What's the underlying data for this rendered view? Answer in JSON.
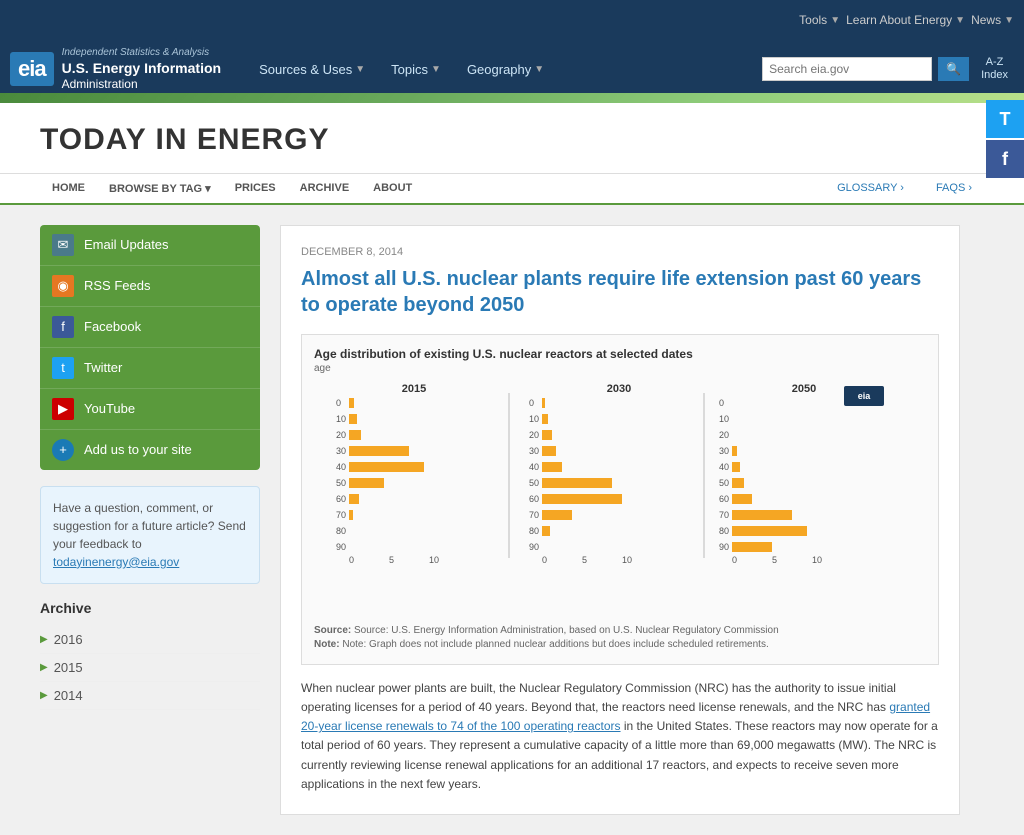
{
  "topbar": {
    "tools_label": "Tools",
    "learn_label": "Learn About Energy",
    "news_label": "News"
  },
  "header": {
    "logo_text": "eia",
    "logo_top": "Independent Statistics & Analysis",
    "logo_mid": "U.S. Energy Information",
    "logo_bot": "Administration",
    "nav": [
      {
        "label": "Sources & Uses",
        "id": "sources-uses"
      },
      {
        "label": "Topics",
        "id": "topics"
      },
      {
        "label": "Geography",
        "id": "geography"
      }
    ],
    "search_placeholder": "Search eia.gov",
    "az_label": "A-Z\nIndex"
  },
  "social_right": [
    {
      "label": "T",
      "name": "twitter",
      "title": "Twitter"
    },
    {
      "label": "f",
      "name": "facebook",
      "title": "Facebook"
    }
  ],
  "page_title": "TODAY IN ENERGY",
  "sub_nav": {
    "items": [
      {
        "label": "HOME",
        "id": "home"
      },
      {
        "label": "BROWSE BY TAG",
        "id": "browse-by-tag"
      },
      {
        "label": "PRICES",
        "id": "prices"
      },
      {
        "label": "ARCHIVE",
        "id": "archive"
      },
      {
        "label": "ABOUT",
        "id": "about"
      }
    ],
    "right_items": [
      {
        "label": "GLOSSARY ›",
        "id": "glossary"
      },
      {
        "label": "FAQS ›",
        "id": "faqs"
      }
    ]
  },
  "sidebar": {
    "social_items": [
      {
        "label": "Email Updates",
        "icon": "✉",
        "id": "email"
      },
      {
        "label": "RSS Feeds",
        "icon": "◈",
        "id": "rss"
      },
      {
        "label": "Facebook",
        "icon": "f",
        "id": "facebook"
      },
      {
        "label": "Twitter",
        "icon": "t",
        "id": "twitter"
      },
      {
        "label": "YouTube",
        "icon": "▶",
        "id": "youtube"
      },
      {
        "label": "Add us to your site",
        "icon": "+",
        "id": "add-site"
      }
    ],
    "feedback_text": "Have a question, comment, or suggestion for a future article? Send your feedback to",
    "feedback_email": "todayinenergy@eia.gov",
    "archive_title": "Archive",
    "archive_years": [
      {
        "year": "2016",
        "id": "2016"
      },
      {
        "year": "2015",
        "id": "2015"
      },
      {
        "year": "2014",
        "id": "2014"
      }
    ]
  },
  "article": {
    "date": "DECEMBER 8, 2014",
    "title": "Almost all U.S. nuclear plants require life extension past 60 years to operate beyond 2050",
    "chart": {
      "title": "Age distribution of existing U.S. nuclear reactors at selected dates",
      "age_label": "age",
      "panels": [
        {
          "year": "2015",
          "x_labels": [
            "0",
            "5",
            "10"
          ],
          "y_labels": [
            "0",
            "10",
            "20",
            "30",
            "40",
            "50",
            "60",
            "70",
            "80",
            "90"
          ]
        },
        {
          "year": "2030",
          "x_labels": [
            "0",
            "5",
            "10"
          ],
          "y_labels": [
            "0",
            "10",
            "20",
            "30",
            "40",
            "50",
            "60",
            "70",
            "80",
            "90"
          ]
        },
        {
          "year": "2050",
          "x_labels": [
            "0",
            "5",
            "10"
          ],
          "y_labels": [
            "0",
            "10",
            "20",
            "30",
            "40",
            "50",
            "60",
            "70",
            "80",
            "90"
          ]
        }
      ],
      "source": "Source: U.S. Energy Information Administration, based on U.S. Nuclear Regulatory Commission",
      "note": "Note: Graph does not include planned nuclear additions but does include scheduled retirements."
    },
    "body_para1": "When nuclear power plants are built, the Nuclear Regulatory Commission (NRC) has the authority to issue initial operating licenses for a period of 40 years. Beyond that, the reactors need license renewals, and the NRC has",
    "body_link": "granted 20-year license renewals to 74 of the 100 operating reactors",
    "body_para2": "in the United States. These reactors may now operate for a total period of 60 years. They represent a cumulative capacity of a little more than 69,000 megawatts (MW). The NRC is currently reviewing license renewal applications for an additional 17 reactors, and expects to receive seven more applications in the next few years."
  }
}
